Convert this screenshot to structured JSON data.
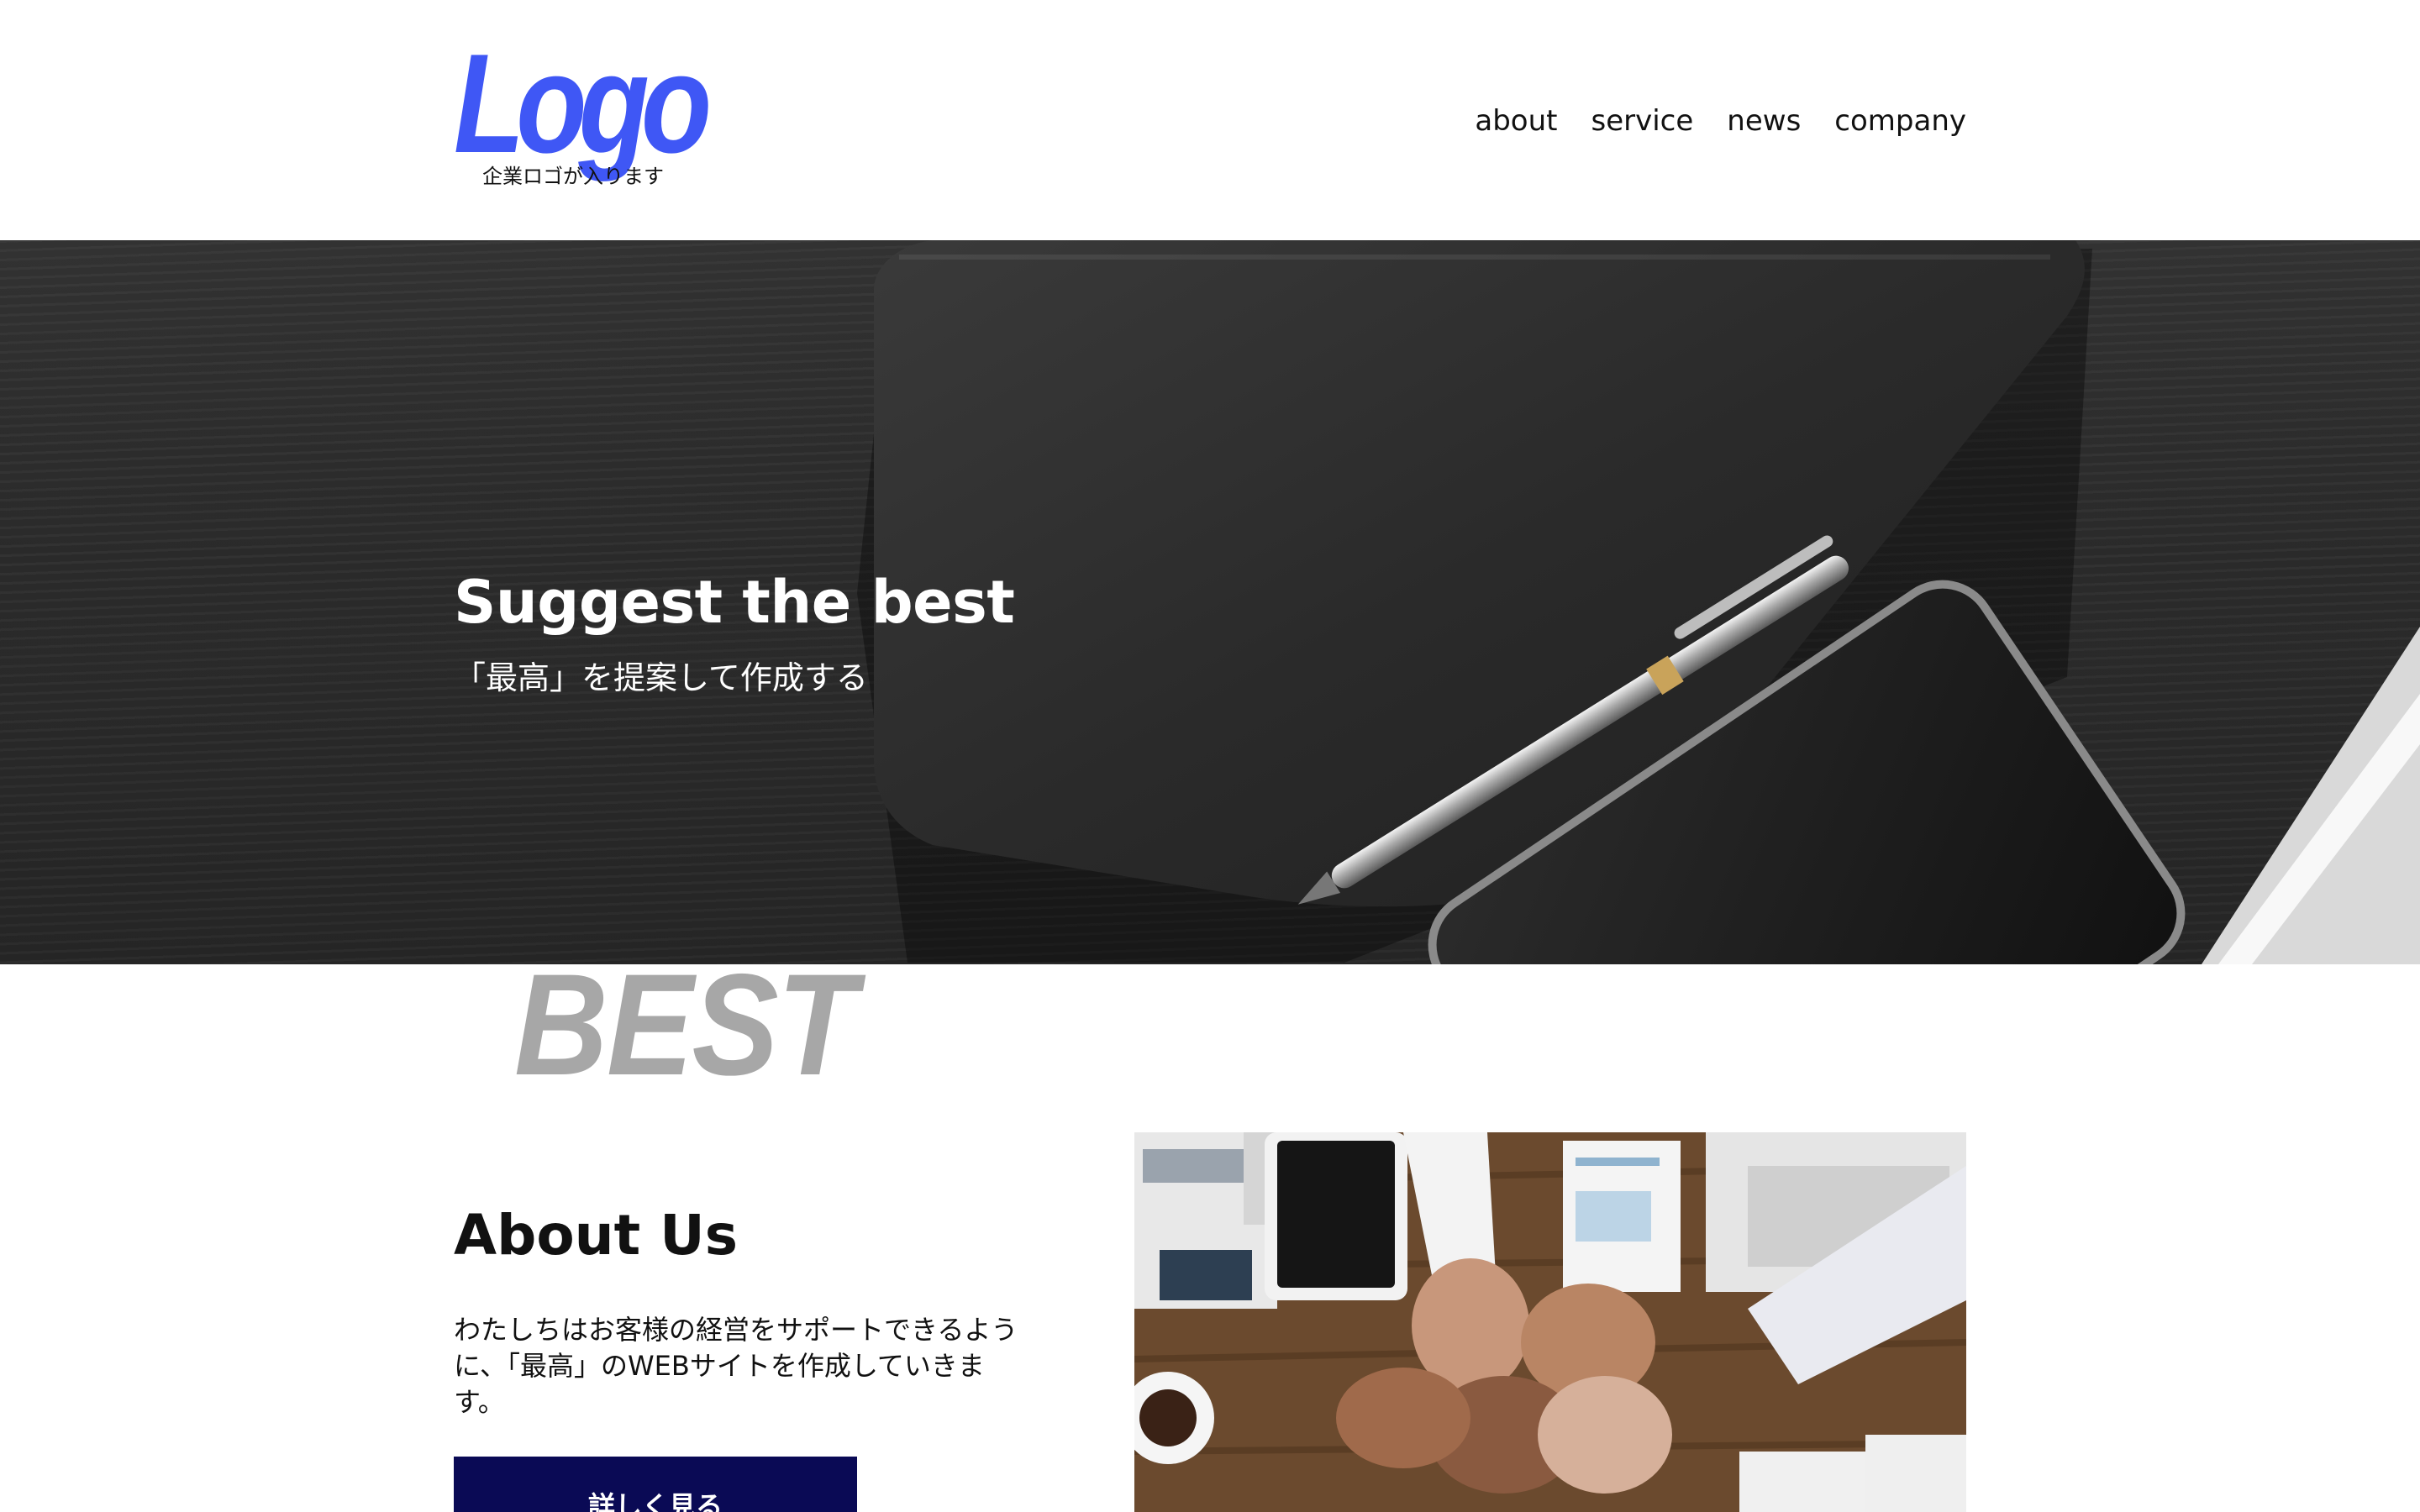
{
  "header": {
    "logo_text": "Logo",
    "logo_tagline": "企業ロゴが入ります",
    "nav": [
      {
        "label": "about"
      },
      {
        "label": "service"
      },
      {
        "label": "news"
      },
      {
        "label": "company"
      }
    ]
  },
  "hero": {
    "title": "Suggest the best",
    "subtitle": "「最高」を提案して作成する"
  },
  "watermark": {
    "text": "BEST"
  },
  "about": {
    "title": "About Us",
    "body": "わたしちはお客様の経営をサポートできるように、「最高」のWEBサイトを作成していきます。",
    "button_label": "詳しく見る"
  },
  "colors": {
    "logo": "#3f57f5",
    "button_bg": "#0a0a55",
    "hero_bg": "#333333",
    "watermark": "#a3a3a3"
  }
}
